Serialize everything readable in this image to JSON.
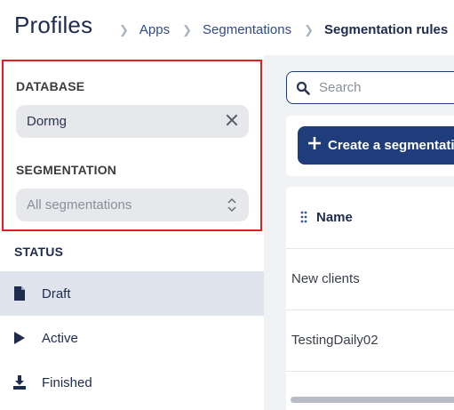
{
  "header": {
    "title": "Profiles",
    "breadcrumb": [
      "Apps",
      "Segmentations",
      "Segmentation rules"
    ]
  },
  "filters": {
    "database": {
      "label": "DATABASE",
      "value": "Dormg"
    },
    "segmentation": {
      "label": "SEGMENTATION",
      "placeholder": "All segmentations"
    }
  },
  "status": {
    "label": "STATUS",
    "items": [
      {
        "label": "Draft",
        "icon": "document-icon",
        "selected": true
      },
      {
        "label": "Active",
        "icon": "play-icon",
        "selected": false
      },
      {
        "label": "Finished",
        "icon": "download-icon",
        "selected": false
      }
    ]
  },
  "main": {
    "search_placeholder": "Search",
    "create_button": "Create a segmentatio",
    "table": {
      "columns": [
        "Name"
      ],
      "rows": [
        "New clients",
        "TestingDaily02"
      ]
    }
  },
  "colors": {
    "accent": "#1f3d7a",
    "selected_row": "#dfe3ee",
    "highlight_border": "#e02020"
  }
}
